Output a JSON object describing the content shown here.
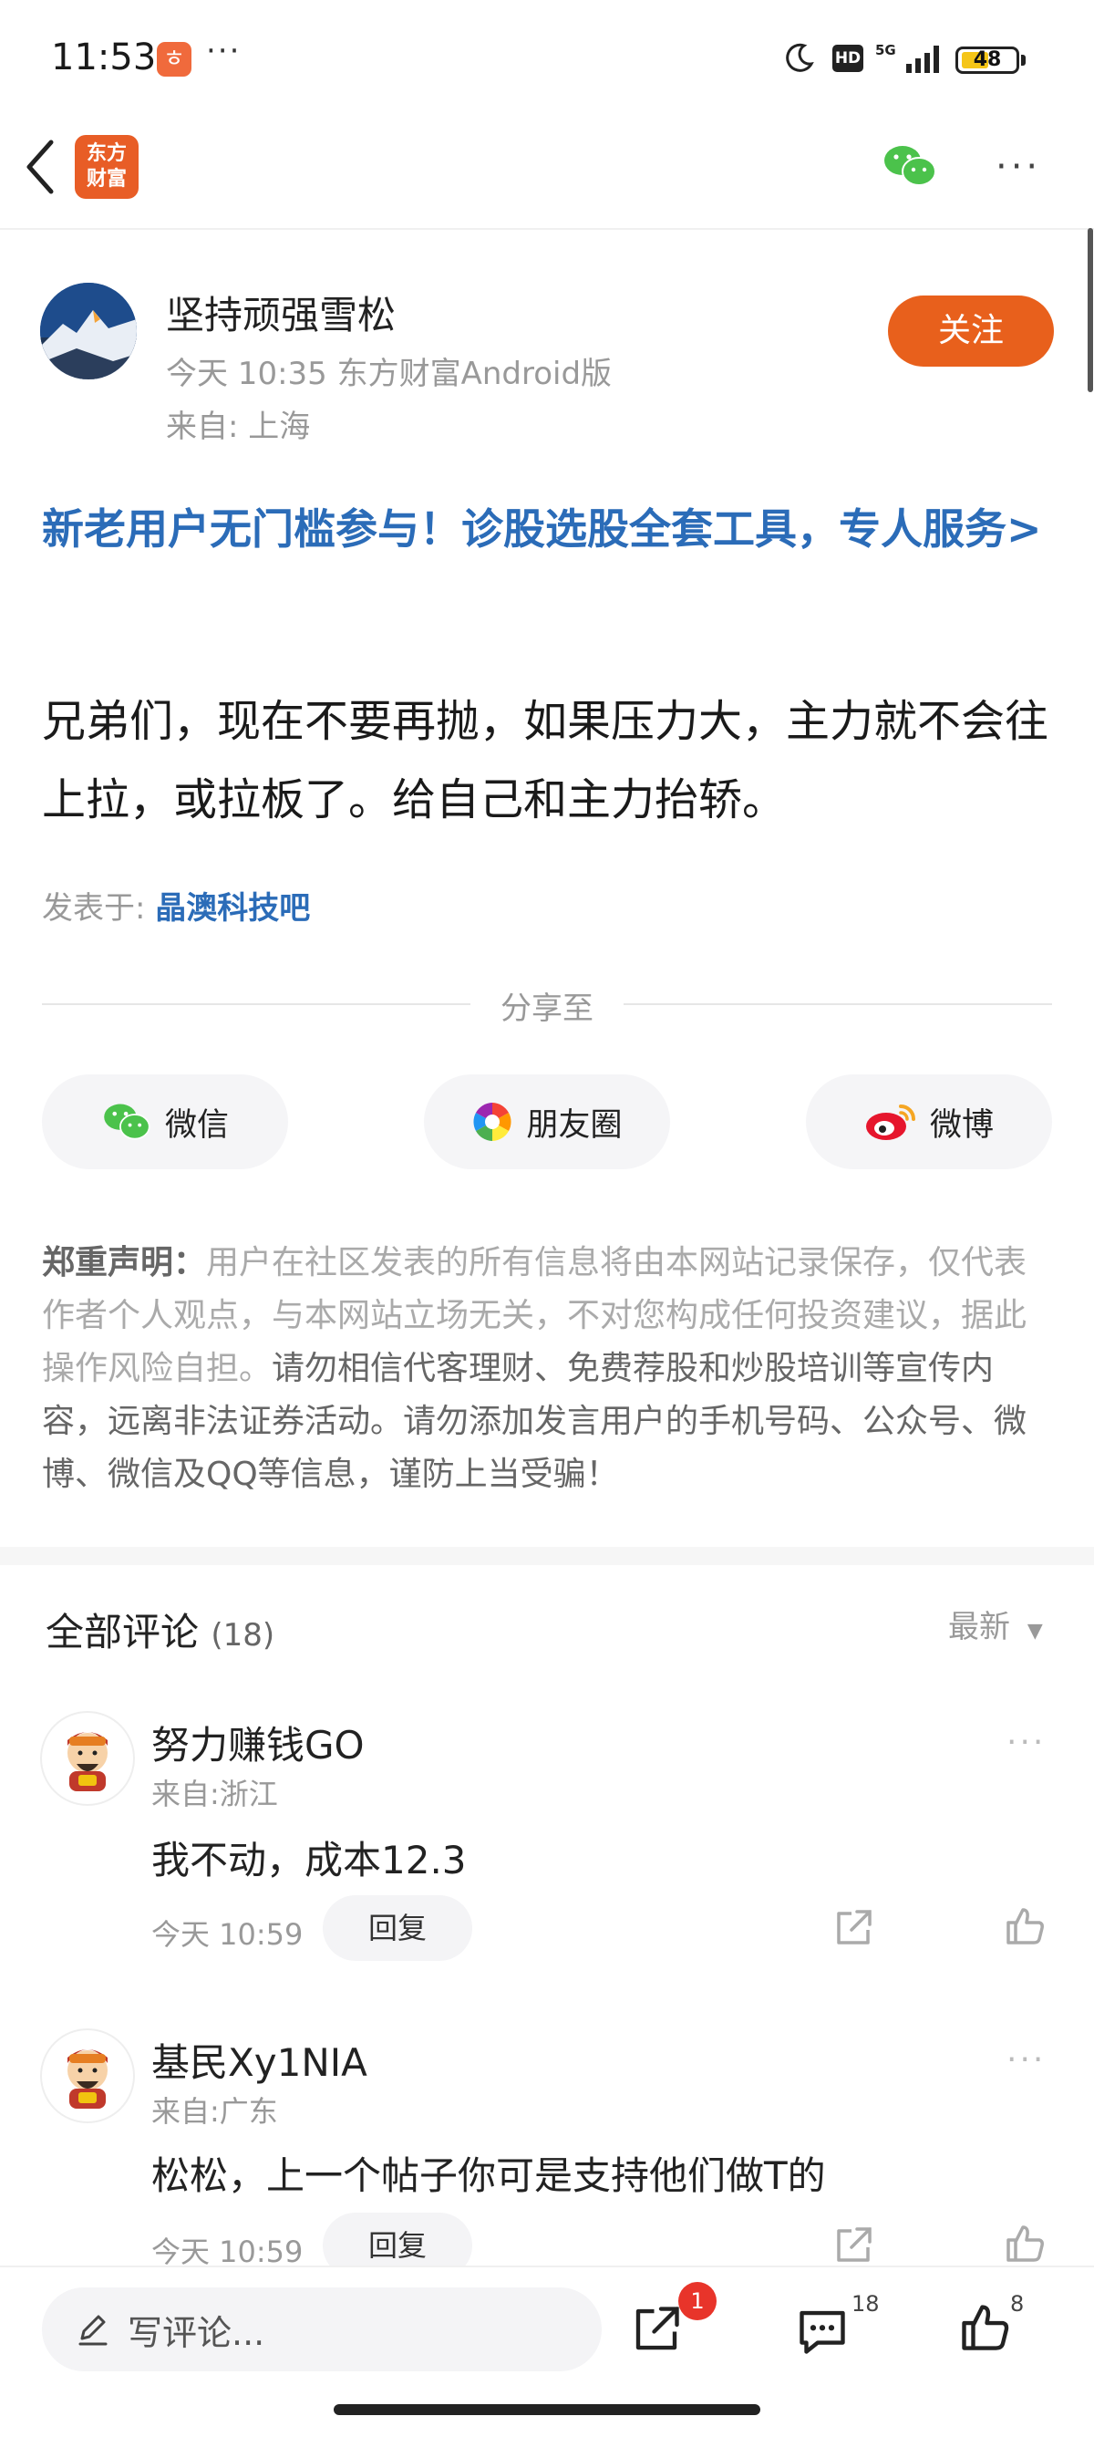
{
  "status_bar": {
    "time": "11:53",
    "app_badge_glyph": "ㅎ",
    "network": "5G",
    "hd_label": "HD",
    "battery": "48"
  },
  "nav": {
    "logo_line1": "东方",
    "logo_line2": "财富"
  },
  "author": {
    "name": "坚持顽强雪松",
    "meta": "今天 10:35 东方财富Android版",
    "location": "来自: 上海",
    "follow_label": "关注"
  },
  "post": {
    "promo": "新老用户无门槛参与！诊股选股全套工具，专人服务>",
    "body": "兄弟们，现在不要再抛，如果压力大，主力就不会往上拉，或拉板了。给自己和主力抬轿。",
    "posted_in_label": "发表于:",
    "posted_in_bar": "晶澳科技吧"
  },
  "share": {
    "title": "分享至",
    "wechat": "微信",
    "moments": "朋友圈",
    "weibo": "微博"
  },
  "disclaimer": {
    "lead": "郑重声明：",
    "part1": "用户在社区发表的所有信息将由本网站记录保存，仅代表作者个人观点，与本网站立场无关，不对您构成任何投资建议，据此操作风险自担。",
    "part2": "请勿相信代客理财、免费荐股和炒股培训等宣传内容，远离非法证券活动。请勿添加发言用户的手机号码、公众号、微博、微信及QQ等信息，谨防上当受骗！"
  },
  "comments": {
    "title": "全部评论",
    "count": "(18)",
    "sort_label": "最新",
    "items": [
      {
        "name": "努力赚钱GO",
        "location": "来自:浙江",
        "text": "我不动，成本12.3",
        "time": "今天 10:59",
        "reply_label": "回复"
      },
      {
        "name": "基民Xy1NIA",
        "location": "来自:广东",
        "text": "松松，上一个帖子你可是支持他们做T的",
        "time": "今天 10:59",
        "reply_label": "回复"
      }
    ]
  },
  "bottom_bar": {
    "write_placeholder": "写评论...",
    "share_badge": "1",
    "comment_count": "18",
    "like_count": "8"
  },
  "colors": {
    "accent_orange": "#e8601c",
    "link_blue": "#2b6cb8",
    "badge_red": "#e8342a"
  }
}
